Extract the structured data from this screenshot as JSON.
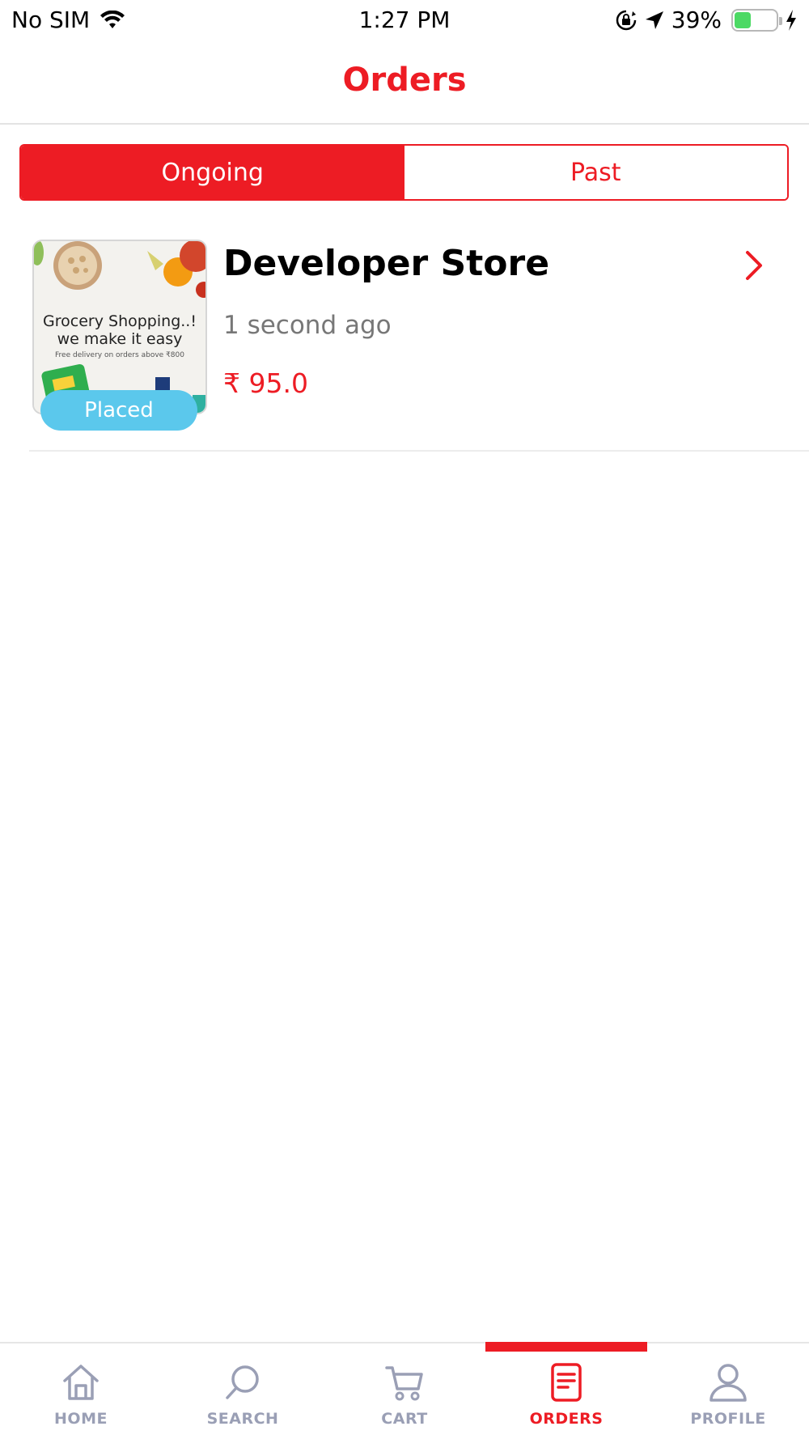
{
  "status_bar": {
    "carrier": "No SIM",
    "time": "1:27 PM",
    "battery_percent": "39%",
    "battery_level": 0.39,
    "icons": [
      "wifi-icon",
      "orientation-lock-icon",
      "location-arrow-icon",
      "battery-icon",
      "charging-bolt-icon"
    ]
  },
  "header": {
    "title": "Orders"
  },
  "segments": {
    "ongoing": "Ongoing",
    "past": "Past",
    "selected": "Ongoing"
  },
  "orders": [
    {
      "store_name": "Developer Store",
      "time_ago": "1 second ago",
      "price": "₹ 95.0",
      "status": "Placed",
      "thumbnail": {
        "line1": "Grocery Shopping..!",
        "line2": "we make it easy",
        "subtext": "Free delivery on orders above ₹800"
      }
    }
  ],
  "tabbar": {
    "items": [
      {
        "label": "HOME",
        "icon": "home-icon"
      },
      {
        "label": "SEARCH",
        "icon": "search-icon"
      },
      {
        "label": "CART",
        "icon": "cart-icon"
      },
      {
        "label": "ORDERS",
        "icon": "orders-icon"
      },
      {
        "label": "PROFILE",
        "icon": "profile-icon"
      }
    ],
    "active": "ORDERS"
  },
  "colors": {
    "accent": "#ed1c24",
    "badge": "#5bc8ec",
    "inactive_tab": "#9a9fb5"
  }
}
